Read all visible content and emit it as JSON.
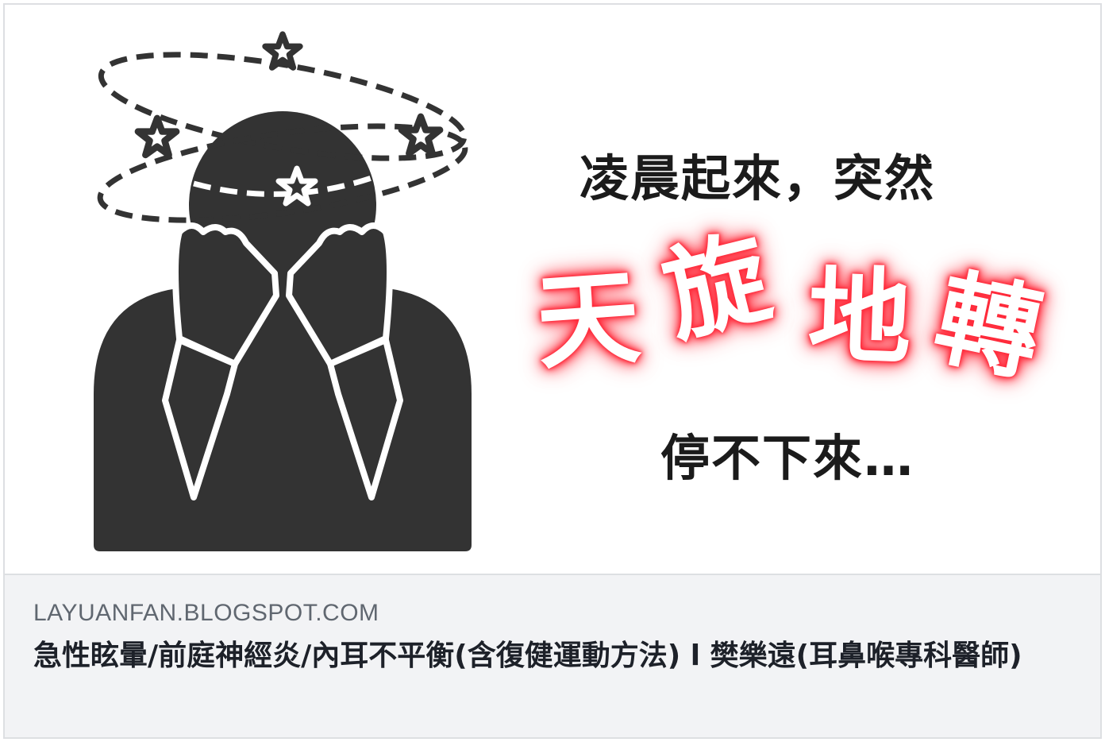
{
  "link_card": {
    "image": {
      "caption_line1": "凌晨起來，突然",
      "caption_highlight": [
        "天",
        "旋",
        "地",
        "轉"
      ],
      "caption_line3": "停不下來…",
      "highlight_glow_color": "#ff2a3a",
      "illustration_icon": "dizzy-person-icon"
    },
    "domain": "LAYUANFAN.BLOGSPOT.COM",
    "title": "急性眩暈/前庭神經炎/內耳不平衡(含復健運動方法) l 樊樂遠(耳鼻喉專科醫師)"
  },
  "colors": {
    "meta_background": "#f2f3f5",
    "domain_text": "#606770",
    "title_text": "#1d2129",
    "illustration_fill": "#333333"
  }
}
